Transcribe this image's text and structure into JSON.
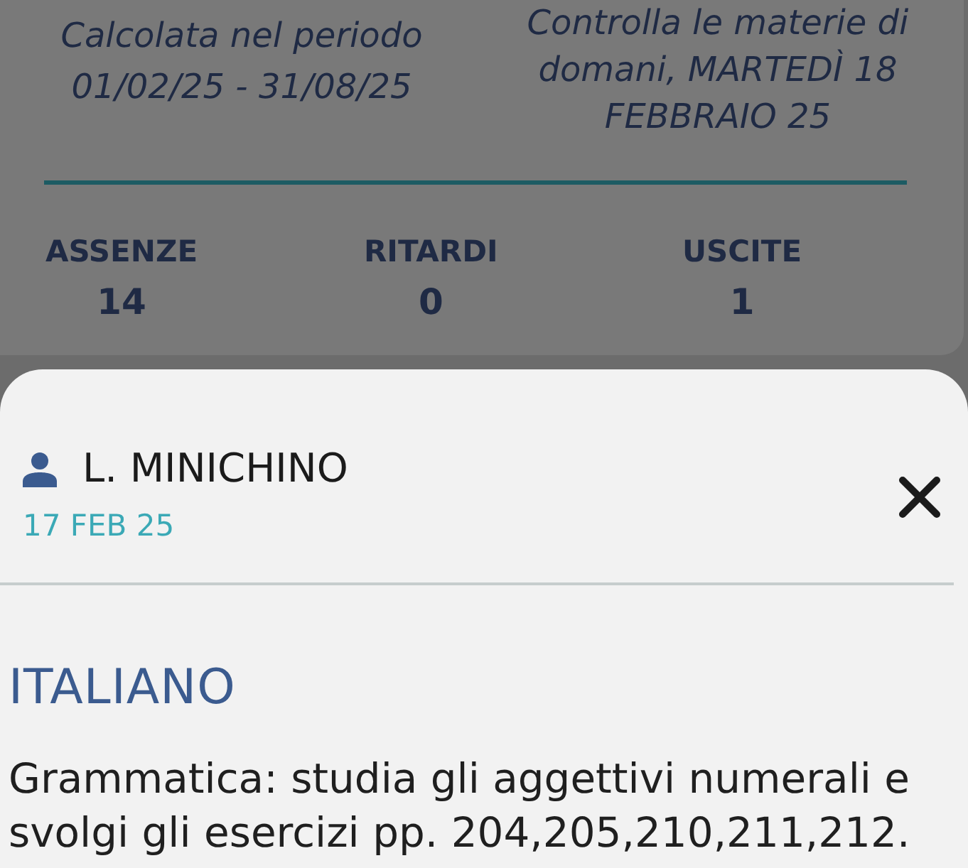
{
  "summary_card": {
    "period_label": "Calcolata nel periodo",
    "period": "01/02/25 - 31/08/25",
    "reminder": "Controlla le materie di domani, MARTEDÌ 18 FEBBRAIO 25",
    "stats": [
      {
        "label": "ASSENZE",
        "value": "14"
      },
      {
        "label": "RITARDI",
        "value": "0"
      },
      {
        "label": "USCITE",
        "value": "1"
      }
    ]
  },
  "homework_sheet": {
    "teacher": "L. MINICHINO",
    "date": "17 FEB 25",
    "subject": "ITALIANO",
    "text": "Grammatica: studia gli aggettivi numerali e svolgi gli esercizi pp. 204,205,210,211,212."
  }
}
